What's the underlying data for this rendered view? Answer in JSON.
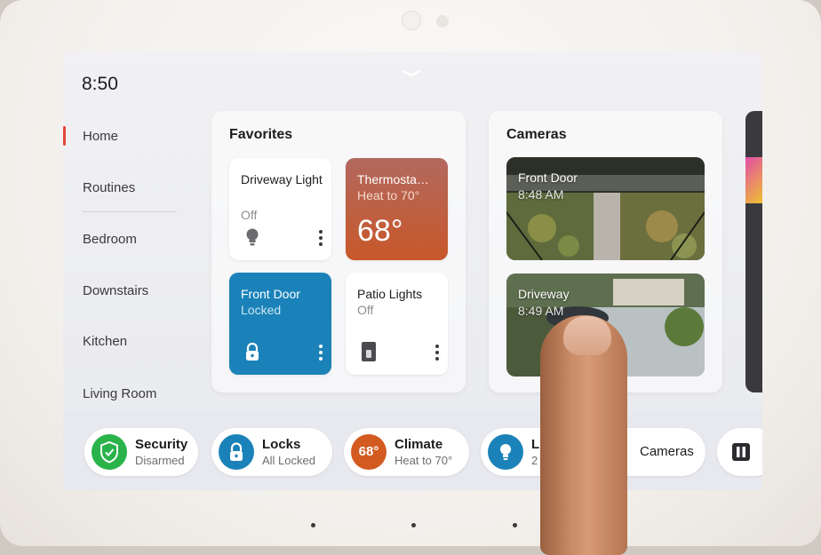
{
  "status": {
    "time": "8:50"
  },
  "nav": {
    "items": [
      {
        "label": "Home",
        "active": true
      },
      {
        "label": "Routines"
      },
      {
        "label": "Bedroom"
      },
      {
        "label": "Downstairs"
      },
      {
        "label": "Kitchen"
      },
      {
        "label": "Living Room"
      }
    ],
    "accent_color": "#e4453c"
  },
  "favorites": {
    "title": "Favorites",
    "tiles": [
      {
        "name": "Driveway Light",
        "state": "Off",
        "icon": "lightbulb-icon"
      },
      {
        "name": "Thermosta…",
        "state": "Heat to 70°",
        "value": "68°",
        "color": "#c4582a"
      },
      {
        "name": "Front Door",
        "state": "Locked",
        "icon": "lock-icon",
        "color": "#1a82b8"
      },
      {
        "name": "Patio Lights",
        "state": "Off",
        "icon": "light-switch-icon"
      }
    ]
  },
  "cameras": {
    "title": "Cameras",
    "feeds": [
      {
        "name": "Front Door",
        "time": "8:48 AM"
      },
      {
        "name": "Driveway",
        "time": "8:49 AM"
      }
    ]
  },
  "quick_bar": {
    "chips": [
      {
        "title": "Security",
        "subtitle": "Disarmed",
        "icon": "shield-check-icon",
        "color": "#2ab34a"
      },
      {
        "title": "Locks",
        "subtitle": "All Locked",
        "icon": "lock-icon",
        "color": "#1a82b8"
      },
      {
        "title": "Climate",
        "subtitle": "Heat to 70°",
        "badge": "68°",
        "color": "#d35a20"
      },
      {
        "title": "Li",
        "subtitle": "2",
        "icon": "lightbulb-icon",
        "color": "#1a82b8"
      },
      {
        "title": "Cameras",
        "icon": "camera-icon"
      },
      {
        "icon": "pause-icon"
      }
    ]
  }
}
